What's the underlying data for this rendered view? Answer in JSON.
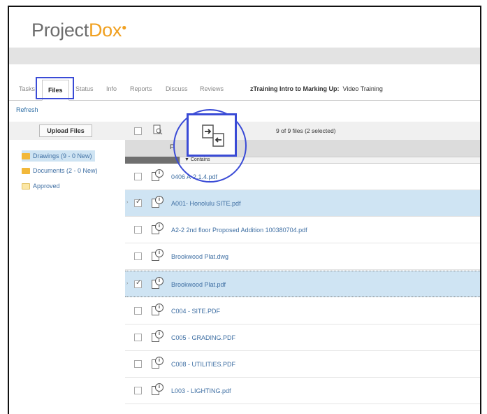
{
  "app": {
    "logo_part1": "Project",
    "logo_part2": "Dox",
    "logo_mark": "●"
  },
  "tabs": [
    {
      "label": "Tasks"
    },
    {
      "label": "Files"
    },
    {
      "label": "Status"
    },
    {
      "label": "Info"
    },
    {
      "label": "Reports"
    },
    {
      "label": "Discuss"
    },
    {
      "label": "Reviews"
    }
  ],
  "project": {
    "name": "zTraining Intro to Marking Up:",
    "subtitle": "Video Training"
  },
  "refresh_label": "Refresh",
  "upload_label": "Upload Files",
  "folders": [
    {
      "label": "Drawings (9 - 0 New)",
      "selected": true,
      "color": "#f2b83a"
    },
    {
      "label": "Documents (2 - 0 New)",
      "selected": false,
      "color": "#f2b83a"
    },
    {
      "label": "Approved",
      "selected": false,
      "color": "#fbe7a6"
    }
  ],
  "toolbar": {
    "count_text": "9 of 9 files (2 selected)"
  },
  "columns": {
    "file_header": "Fi",
    "filter_label": "▼ Contains"
  },
  "files": [
    {
      "name": "0406 A-2.1.4.pdf",
      "checked": false
    },
    {
      "name": "A001- Honolulu SITE.pdf",
      "checked": true
    },
    {
      "name": "A2-2 2nd floor Proposed Addition 100380704.pdf",
      "checked": false
    },
    {
      "name": "Brookwood Plat.dwg",
      "checked": false
    },
    {
      "name": "Brookwood Plat.pdf",
      "checked": true
    },
    {
      "name": "C004 - SITE.PDF",
      "checked": false
    },
    {
      "name": "C005 - GRADING.PDF",
      "checked": false
    },
    {
      "name": "C008 - UTILITIES.PDF",
      "checked": false
    },
    {
      "name": "L003 - LIGHTING.pdf",
      "checked": false
    }
  ],
  "colors": {
    "highlight": "#3a4bd6",
    "selected_row": "#cfe4f3",
    "link": "#3f6fa3"
  }
}
